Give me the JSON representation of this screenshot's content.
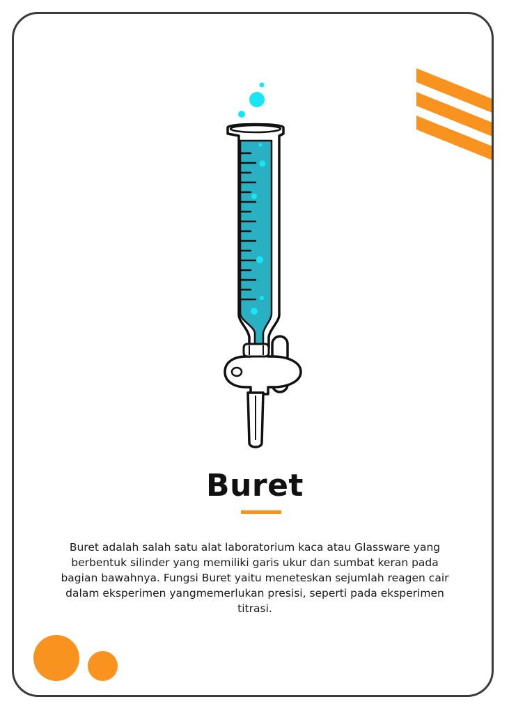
{
  "card": {
    "title": "Buret",
    "description": "Buret adalah salah satu alat laboratorium kaca atau Glassware yang berbentuk  silinder  yang memiliki garis ukur dan sumbat keran pada bagian bawahnya. Fungsi Buret yaitu meneteskan sejumlah reagen cair dalam eksperimen yangmemerlukan presisi, seperti pada eksperimen titrasi.",
    "illustration": "buret-icon"
  },
  "colors": {
    "accent": "#f7931e",
    "liquid": "#29b0c2",
    "bubble": "#19e6f2",
    "outline": "#111111",
    "border": "#3a3a3a"
  }
}
